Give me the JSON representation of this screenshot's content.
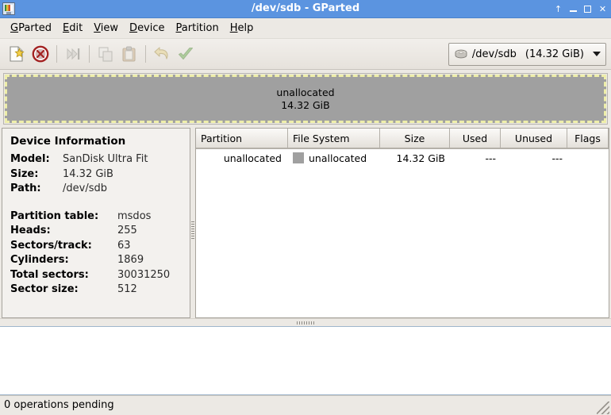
{
  "window": {
    "title": "/dev/sdb - GParted",
    "icon": "gparted-app-icon",
    "buttons": [
      {
        "name": "shade-button",
        "glyph": "↑"
      },
      {
        "name": "minimize-button",
        "glyph": "–"
      },
      {
        "name": "maximize-button",
        "glyph": "□"
      },
      {
        "name": "close-button",
        "glyph": "✕"
      }
    ]
  },
  "menubar": {
    "items": [
      {
        "mnemonic": "G",
        "rest": "Parted"
      },
      {
        "mnemonic": "E",
        "rest": "dit"
      },
      {
        "mnemonic": "V",
        "rest": "iew"
      },
      {
        "mnemonic": "D",
        "rest": "evice"
      },
      {
        "mnemonic": "P",
        "rest": "artition"
      },
      {
        "mnemonic": "H",
        "rest": "elp"
      }
    ]
  },
  "toolbar": {
    "buttons": [
      {
        "name": "new-partition-button",
        "icon": "new-document-icon",
        "enabled": true
      },
      {
        "name": "delete-partition-button",
        "icon": "delete-forbidden-icon",
        "enabled": true
      },
      {
        "name": "resize-move-button",
        "icon": "resize-move-icon",
        "enabled": false
      },
      {
        "name": "copy-button",
        "icon": "copy-icon",
        "enabled": false
      },
      {
        "name": "paste-button",
        "icon": "paste-clipboard-icon",
        "enabled": false
      },
      {
        "name": "undo-button",
        "icon": "undo-arrow-icon",
        "enabled": false
      },
      {
        "name": "apply-button",
        "icon": "apply-check-icon",
        "enabled": false
      }
    ],
    "device_selector": {
      "icon": "hard-disk-icon",
      "device": "/dev/sdb",
      "size": "(14.32 GiB)"
    }
  },
  "disk_graphic": {
    "partition": {
      "label": "unallocated",
      "size": "14.32 GiB",
      "fill_color": "#a0a0a0",
      "border_color": "#eeeeaa"
    }
  },
  "device_information": {
    "heading": "Device Information",
    "group1": [
      {
        "key": "Model:",
        "value": "SanDisk Ultra Fit"
      },
      {
        "key": "Size:",
        "value": "14.32 GiB"
      },
      {
        "key": "Path:",
        "value": "/dev/sdb"
      }
    ],
    "group2": [
      {
        "key": "Partition table:",
        "value": "msdos"
      },
      {
        "key": "Heads:",
        "value": "255"
      },
      {
        "key": "Sectors/track:",
        "value": "63"
      },
      {
        "key": "Cylinders:",
        "value": "1869"
      },
      {
        "key": "Total sectors:",
        "value": "30031250"
      },
      {
        "key": "Sector size:",
        "value": "512"
      }
    ]
  },
  "partition_table": {
    "columns": [
      {
        "label": "Partition",
        "width": 116,
        "align": "left"
      },
      {
        "label": "File System",
        "width": 116,
        "align": "left"
      },
      {
        "label": "Size",
        "width": 88,
        "align": "center"
      },
      {
        "label": "Used",
        "width": 64,
        "align": "center"
      },
      {
        "label": "Unused",
        "width": 84,
        "align": "center"
      },
      {
        "label": "Flags",
        "width": 58,
        "align": "center"
      }
    ],
    "rows": [
      {
        "partition": "unallocated",
        "file_system": "unallocated",
        "fs_color": "#a0a0a0",
        "size": "14.32 GiB",
        "used": "---",
        "unused": "---",
        "flags": ""
      }
    ]
  },
  "statusbar": {
    "text": "0 operations pending"
  }
}
